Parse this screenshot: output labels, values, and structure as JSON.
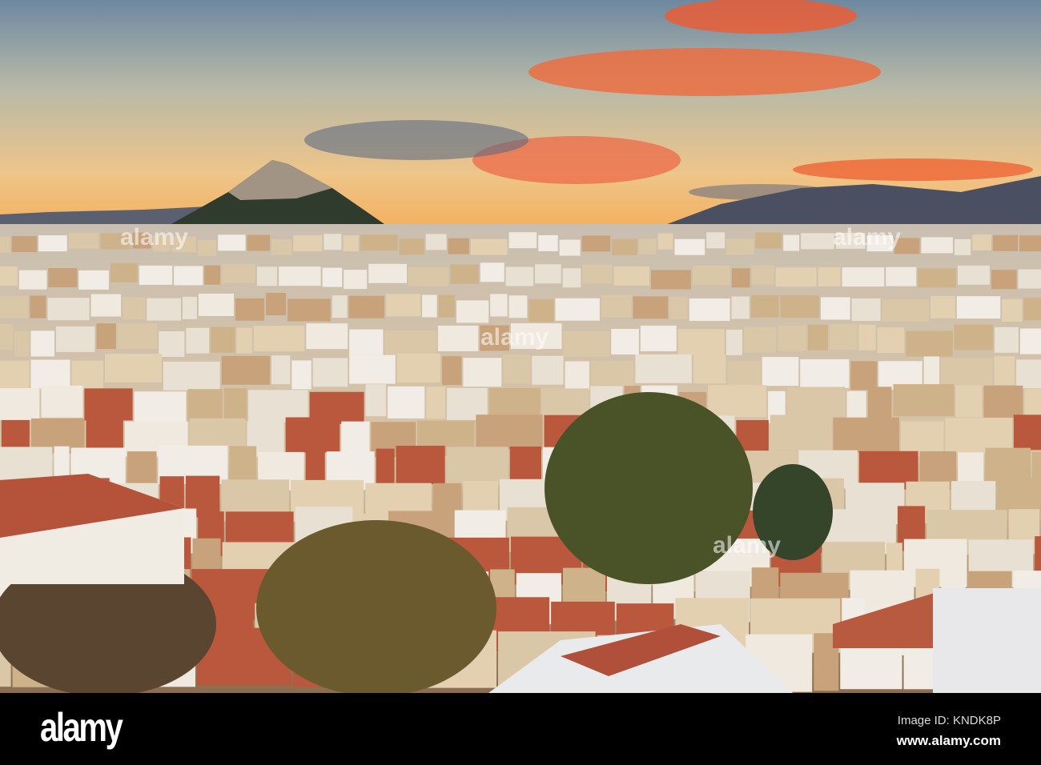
{
  "photo": {
    "subject": "Athens cityscape at sunset with Lycabettus hill"
  },
  "watermark": {
    "text": "alamy"
  },
  "footer": {
    "logo": "alamy",
    "image_id": "Image ID: KNDK8P",
    "website": "www.alamy.com"
  },
  "colors": {
    "sky_top": "#6f8aa0",
    "sky_horizon": "#f5b65a",
    "cloud": "#f2603a",
    "roof": "#b8553a"
  }
}
